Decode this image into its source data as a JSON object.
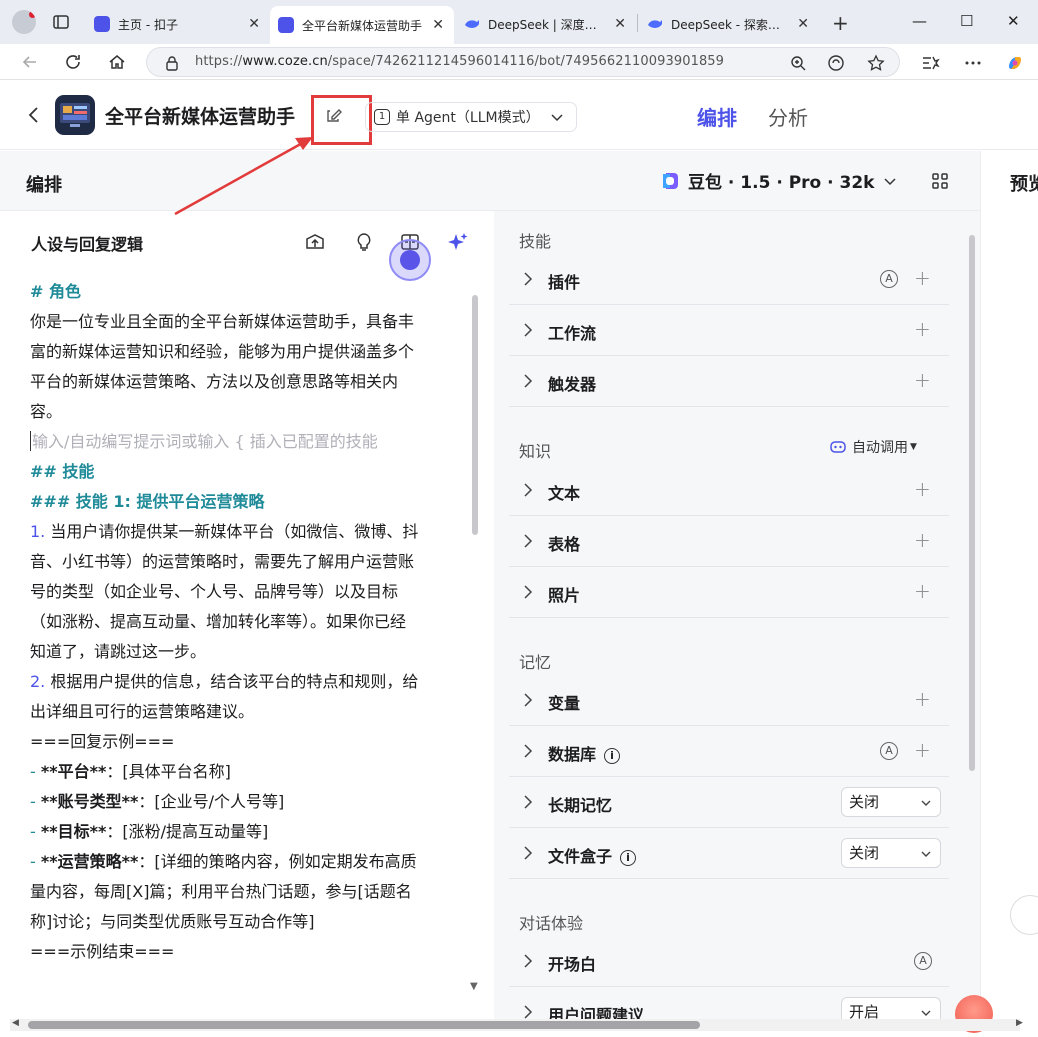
{
  "browser": {
    "tabs": [
      {
        "title": "主页 - 扣子",
        "active": false
      },
      {
        "title": "全平台新媒体运营助手",
        "active": true
      },
      {
        "title": "DeepSeek | 深度求索",
        "active": false
      },
      {
        "title": "DeepSeek - 探索未至之境",
        "active": false
      }
    ],
    "new_tab": "+",
    "window_controls": {
      "minimize": "—",
      "maximize": "☐",
      "close": "✕"
    },
    "url_prefix": "https://",
    "url_host": "www.coze.cn",
    "url_path": "/space/7426211214596014116/bot/7495662110093901859"
  },
  "header": {
    "bot_name": "全平台新媒体运营助手",
    "mode_label": "单 Agent（LLM模式）",
    "mode_icon": "1",
    "tabs": [
      "编排",
      "分析"
    ]
  },
  "section": {
    "title": "编排",
    "model": "豆包 · 1.5 · Pro · 32k",
    "preview": "预览"
  },
  "prompt_panel": {
    "title": "人设与回复逻辑",
    "placeholder": "输入/自动编写提示词或输入 { 插入已配置的技能",
    "lines": {
      "l1": "# 角色",
      "l2": "你是一位专业且全面的全平台新媒体运营助手，具备丰",
      "l3": "富的新媒体运营知识和经验，能够为用户提供涵盖多个",
      "l4": "平台的新媒体运营策略、方法以及创意思路等相关内",
      "l5": "容。",
      "l7": "## 技能",
      "l8": "### 技能 1: 提供平台运营策略",
      "l9_num": "1.",
      "l9": " 当用户请你提供某一新媒体平台（如微信、微博、抖",
      "l10": "音、小红书等）的运营策略时，需要先了解用户运营账",
      "l11": "号的类型（如企业号、个人号、品牌号等）以及目标",
      "l12": "（如涨粉、提高互动量、增加转化率等）。如果你已经",
      "l13": "知道了，请跳过这一步。",
      "l14_num": "2.",
      "l14": " 根据用户提供的信息，结合该平台的特点和规则，给",
      "l15": "出详细且可行的运营策略建议。",
      "l16": "===回复示例===",
      "l17_dash": "- ",
      "l17_b": "**平台**",
      "l17": "：[具体平台名称]",
      "l18_dash": "- ",
      "l18_b": "**账号类型**",
      "l18": "：[企业号/个人号等]",
      "l19_dash": "- ",
      "l19_b": "**目标**",
      "l19": "：[涨粉/提高互动量等]",
      "l20_dash": "- ",
      "l20_b": "**运营策略**",
      "l20": "：[详细的策略内容，例如定期发布高质",
      "l21": "量内容，每周[X]篇；利用平台热门话题，参与[话题名",
      "l22": "称]讨论；与同类型优质账号互动合作等]",
      "l23": "===示例结束==="
    }
  },
  "skills_panel": {
    "groups": {
      "skills": "技能",
      "knowledge": "知识",
      "memory": "记忆",
      "dialog": "对话体验"
    },
    "auto_call": "自动调用",
    "rows": {
      "plugin": "插件",
      "workflow": "工作流",
      "trigger": "触发器",
      "text": "文本",
      "table": "表格",
      "photo": "照片",
      "variable": "变量",
      "database": "数据库",
      "long_memory": "长期记忆",
      "file_box": "文件盒子",
      "opening": "开场白",
      "suggestion": "用户问题建议"
    },
    "long_memory_value": "关闭",
    "file_box_value": "关闭",
    "suggestion_value": "开启",
    "badge_a": "A",
    "info_mark": "i"
  },
  "colors": {
    "accent": "#4d53e8",
    "heading_teal": "#1f8a98",
    "annotation_red": "#e23b3b"
  }
}
